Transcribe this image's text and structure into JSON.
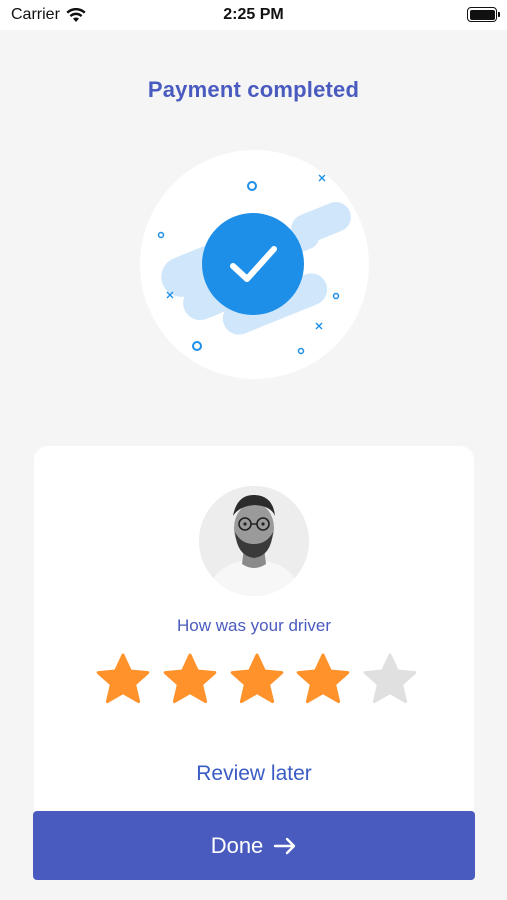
{
  "status_bar": {
    "carrier": "Carrier",
    "time": "2:25 PM",
    "icons": [
      "wifi-icon",
      "battery-icon"
    ]
  },
  "header": {
    "title": "Payment completed"
  },
  "illustration": {
    "icon": "checkmark-icon",
    "accent_color": "#1e8fe8"
  },
  "rating_card": {
    "avatar": "driver-avatar",
    "question": "How was your driver",
    "rating": 4,
    "max_rating": 5,
    "star_filled_color": "#ff922b",
    "star_empty_color": "#e0e0e0",
    "review_later_label": "Review later"
  },
  "footer": {
    "done_label": "Done",
    "done_icon": "arrow-right-icon",
    "button_color": "#4a5bbf"
  }
}
